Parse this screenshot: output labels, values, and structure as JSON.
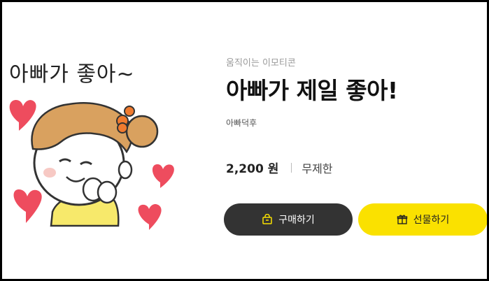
{
  "artwork": {
    "title": "아빠가 좋아~",
    "colors": {
      "heart": "#ee4c5e",
      "hair": "#d9a15f",
      "ribbon": "#f07b2f",
      "shirt": "#f7e96b"
    }
  },
  "product": {
    "category": "움직이는 이모티콘",
    "title": "아빠가 제일 좋아!",
    "author": "아빠덕후",
    "price": "2,200 원",
    "period": "무제한"
  },
  "actions": {
    "buy_label": "구매하기",
    "gift_label": "선물하기",
    "buy_icon": "shopping-bag-icon",
    "gift_icon": "gift-icon"
  },
  "colors": {
    "buy_bg": "#333333",
    "gift_bg": "#fae100"
  }
}
